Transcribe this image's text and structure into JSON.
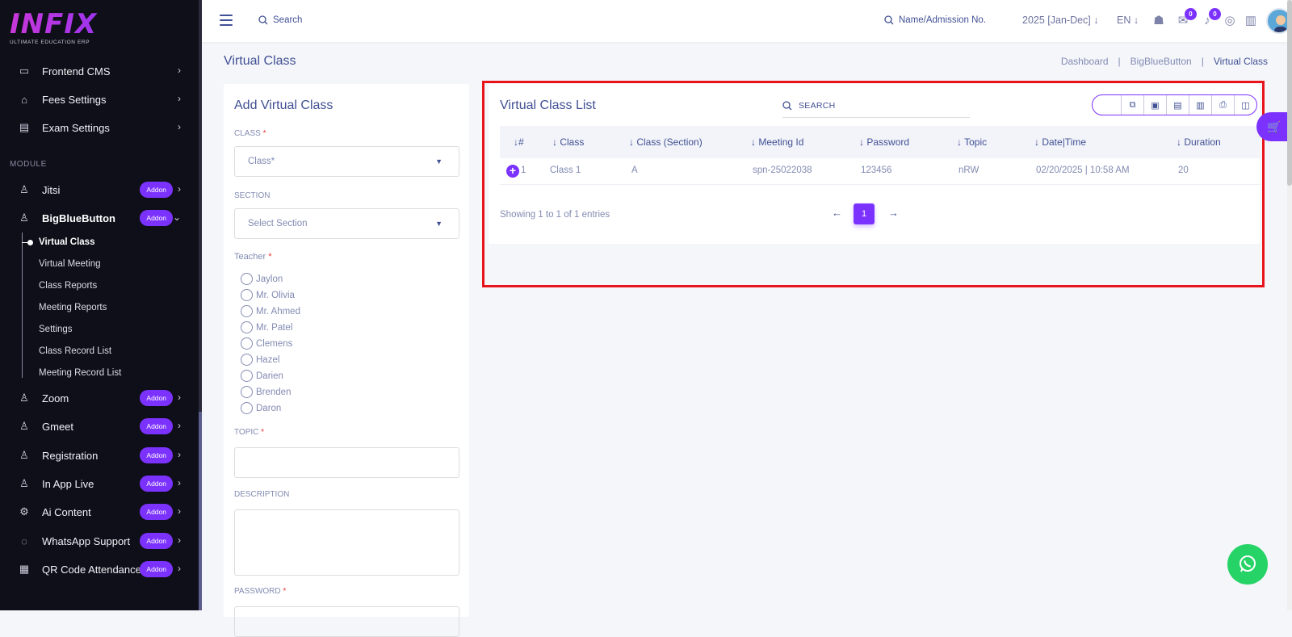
{
  "brand": {
    "logo": "INFIX",
    "tagline": "ULTIMATE EDUCATION ERP"
  },
  "sidebar": {
    "top_items": [
      {
        "label": "Frontend CMS",
        "icon": "monitor-icon"
      },
      {
        "label": "Fees Settings",
        "icon": "bank-icon"
      },
      {
        "label": "Exam Settings",
        "icon": "book-icon"
      }
    ],
    "section_label": "MODULE",
    "modules": [
      {
        "label": "Jitsi",
        "badge": "Addon"
      },
      {
        "label": "BigBlueButton",
        "badge": "Addon"
      }
    ],
    "sub_items": [
      "Virtual Class",
      "Virtual Meeting",
      "Class Reports",
      "Meeting Reports",
      "Settings",
      "Class Record List",
      "Meeting Record List"
    ],
    "more_modules": [
      {
        "label": "Zoom",
        "badge": "Addon"
      },
      {
        "label": "Gmeet",
        "badge": "Addon"
      },
      {
        "label": "Registration",
        "badge": "Addon"
      },
      {
        "label": "In App Live",
        "badge": "Addon"
      },
      {
        "label": "Ai Content",
        "badge": "Addon"
      },
      {
        "label": "WhatsApp Support",
        "badge": "Addon"
      },
      {
        "label": "QR Code Attendance",
        "badge": "Addon"
      }
    ]
  },
  "topbar": {
    "search_label": "Search",
    "name_search": "Name/Admission No.",
    "year": "2025 [Jan-Dec]",
    "lang": "EN",
    "chat_count": "0",
    "notif_count": "0"
  },
  "page": {
    "title": "Virtual Class",
    "breadcrumb": [
      "Dashboard",
      "BigBlueButton",
      "Virtual Class"
    ]
  },
  "form": {
    "title": "Add Virtual Class",
    "class_label": "CLASS",
    "class_placeholder": "Class*",
    "section_label": "SECTION",
    "section_placeholder": "Select Section",
    "teacher_label": "Teacher",
    "teachers": [
      "Jaylon",
      "Mr. Olivia",
      "Mr. Ahmed",
      "Mr. Patel",
      "Clemens",
      "Hazel",
      "Darien",
      "Brenden",
      "Daron"
    ],
    "topic_label": "TOPIC",
    "description_label": "DESCRIPTION",
    "password_label": "PASSWORD"
  },
  "list": {
    "title": "Virtual Class List",
    "search_placeholder": "SEARCH",
    "columns": [
      "#",
      "Class",
      "Class (Section)",
      "Meeting Id",
      "Password",
      "Topic",
      "Date|Time",
      "Duration"
    ],
    "rows": [
      {
        "num": "1",
        "class": "Class 1",
        "section": "A",
        "meeting_id": "spn-25022038",
        "password": "123456",
        "topic": "nRW",
        "datetime": "02/20/2025 | 10:58 AM",
        "duration": "20"
      }
    ],
    "showing": "Showing 1 to 1 of 1 entries",
    "current_page": "1"
  },
  "colors": {
    "accent": "#7c32ff",
    "sidebar_bg": "#0f0f1a",
    "text": "#415094",
    "highlight": "#e8141c",
    "whatsapp": "#25d366"
  }
}
